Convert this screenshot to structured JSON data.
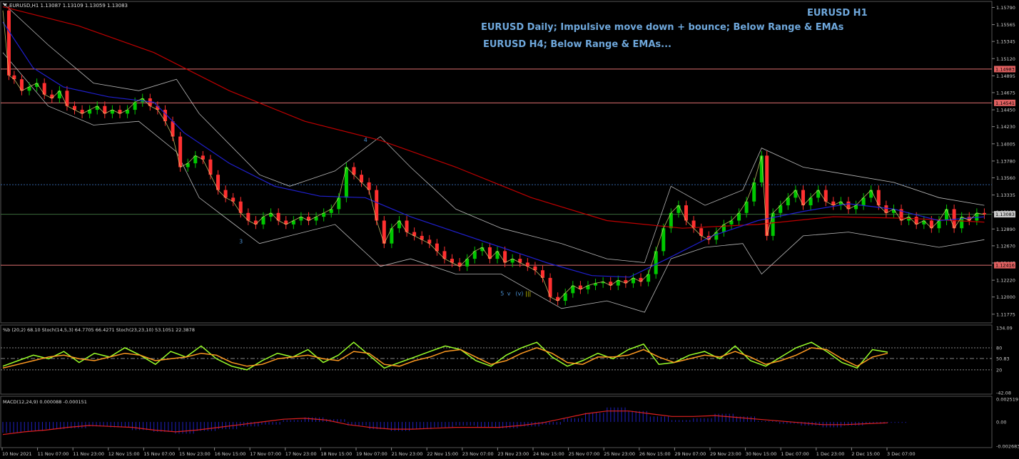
{
  "window": {
    "symbol_header": "EURUSD,H1  1.13087 1.13109 1.13059 1.13083",
    "corner_icon": "triangle-down-icon"
  },
  "annotations": {
    "title_h1": "EURUSD H1",
    "daily_note": "EURUSD Daily; Impulsive move down + bounce; Below Range & EMAs",
    "h4_note": "EURUSD H4; Below Range & EMAs..."
  },
  "wave_labels": [
    "3",
    "4",
    "5",
    "v",
    "(v)",
    "|||"
  ],
  "colors": {
    "background": "#000000",
    "bull_candle": "#00c800",
    "bear_candle": "#ff3030",
    "ema_fast": "#e8e07a",
    "ema_slow": "#2020d0",
    "ema_long": "#c00000",
    "bands": "#b8b8b8",
    "annotation": "#6fa8dc",
    "level_line": "#e07070",
    "stoch_main": "#9aff2a",
    "stoch_slow": "#ff9a20",
    "macd_hist": "#2020c0",
    "macd_signal": "#e02020"
  },
  "chart_data": [
    {
      "type": "candlestick",
      "pane": "price",
      "title": "EURUSD,H1",
      "ylim": [
        1.1168,
        1.1585
      ],
      "y_ticks": [
        "1.15790",
        "1.15565",
        "1.15345",
        "1.15120",
        "1.14895",
        "1.14675",
        "1.14450",
        "1.14230",
        "1.14005",
        "1.13780",
        "1.13560",
        "1.13335",
        "1.13110",
        "1.12890",
        "1.12670",
        "1.12445",
        "1.12220",
        "1.12000",
        "1.11775"
      ],
      "price_labels": [
        {
          "value": 1.14983,
          "text": "1.14983"
        },
        {
          "value": 1.14541,
          "text": "1.14541"
        },
        {
          "value": 1.13083,
          "text": "1.13083"
        },
        {
          "value": 1.12416,
          "text": "1.12416"
        }
      ],
      "horizontal_levels": [
        1.14983,
        1.14541,
        1.12416
      ],
      "current_price_line": 1.13083,
      "dotted_level": 1.1347,
      "x_labels": [
        "10 Nov 2021",
        "11 Nov 07:00",
        "11 Nov 23:00",
        "12 Nov 15:00",
        "15 Nov 07:00",
        "15 Nov 23:00",
        "16 Nov 15:00",
        "17 Nov 07:00",
        "17 Nov 23:00",
        "18 Nov 15:00",
        "19 Nov 07:00",
        "21 Nov 23:00",
        "22 Nov 15:00",
        "23 Nov 07:00",
        "23 Nov 23:00",
        "24 Nov 15:00",
        "25 Nov 07:00",
        "25 Nov 23:00",
        "26 Nov 15:00",
        "29 Nov 07:00",
        "29 Nov 23:00",
        "30 Nov 15:00",
        "1 Dec 07:00",
        "1 Dec 23:00",
        "2 Dec 15:00",
        "3 Dec 07:00"
      ],
      "close_path": [
        [
          0,
          1.1575
        ],
        [
          8,
          1.149
        ],
        [
          15,
          1.1485
        ],
        [
          25,
          1.147
        ],
        [
          35,
          1.1475
        ],
        [
          45,
          1.148
        ],
        [
          55,
          1.1465
        ],
        [
          65,
          1.146
        ],
        [
          75,
          1.147
        ],
        [
          85,
          1.145
        ],
        [
          95,
          1.1445
        ],
        [
          105,
          1.144
        ],
        [
          115,
          1.1445
        ],
        [
          125,
          1.145
        ],
        [
          135,
          1.144
        ],
        [
          145,
          1.1445
        ],
        [
          155,
          1.144
        ],
        [
          165,
          1.1445
        ],
        [
          175,
          1.1455
        ],
        [
          185,
          1.146
        ],
        [
          195,
          1.145
        ],
        [
          205,
          1.1445
        ],
        [
          215,
          1.143
        ],
        [
          225,
          1.141
        ],
        [
          235,
          1.137
        ],
        [
          245,
          1.1375
        ],
        [
          255,
          1.1385
        ],
        [
          265,
          1.138
        ],
        [
          275,
          1.136
        ],
        [
          285,
          1.134
        ],
        [
          295,
          1.133
        ],
        [
          305,
          1.1325
        ],
        [
          315,
          1.131
        ],
        [
          325,
          1.13
        ],
        [
          335,
          1.1295
        ],
        [
          345,
          1.1305
        ],
        [
          355,
          1.131
        ],
        [
          365,
          1.13
        ],
        [
          375,
          1.1295
        ],
        [
          385,
          1.13
        ],
        [
          395,
          1.1305
        ],
        [
          405,
          1.13
        ],
        [
          415,
          1.1305
        ],
        [
          425,
          1.131
        ],
        [
          435,
          1.1315
        ],
        [
          445,
          1.133
        ],
        [
          455,
          1.137
        ],
        [
          465,
          1.136
        ],
        [
          475,
          1.135
        ],
        [
          485,
          1.134
        ],
        [
          495,
          1.13
        ],
        [
          505,
          1.127
        ],
        [
          515,
          1.129
        ],
        [
          525,
          1.13
        ],
        [
          535,
          1.1285
        ],
        [
          545,
          1.128
        ],
        [
          555,
          1.1275
        ],
        [
          565,
          1.127
        ],
        [
          575,
          1.126
        ],
        [
          585,
          1.125
        ],
        [
          595,
          1.1245
        ],
        [
          605,
          1.124
        ],
        [
          615,
          1.125
        ],
        [
          625,
          1.126
        ],
        [
          635,
          1.1265
        ],
        [
          645,
          1.125
        ],
        [
          655,
          1.126
        ],
        [
          665,
          1.1245
        ],
        [
          675,
          1.125
        ],
        [
          685,
          1.1245
        ],
        [
          695,
          1.124
        ],
        [
          705,
          1.1235
        ],
        [
          715,
          1.1225
        ],
        [
          725,
          1.12
        ],
        [
          735,
          1.1195
        ],
        [
          745,
          1.1205
        ],
        [
          755,
          1.1215
        ],
        [
          765,
          1.121
        ],
        [
          775,
          1.1215
        ],
        [
          785,
          1.1218
        ],
        [
          795,
          1.122
        ],
        [
          805,
          1.1215
        ],
        [
          815,
          1.1222
        ],
        [
          825,
          1.1218
        ],
        [
          835,
          1.1225
        ],
        [
          845,
          1.122
        ],
        [
          855,
          1.123
        ],
        [
          865,
          1.126
        ],
        [
          875,
          1.129
        ],
        [
          885,
          1.131
        ],
        [
          895,
          1.132
        ],
        [
          905,
          1.13
        ],
        [
          915,
          1.129
        ],
        [
          925,
          1.128
        ],
        [
          935,
          1.1275
        ],
        [
          945,
          1.1285
        ],
        [
          955,
          1.1295
        ],
        [
          965,
          1.13
        ],
        [
          975,
          1.131
        ],
        [
          985,
          1.1325
        ],
        [
          995,
          1.135
        ],
        [
          1005,
          1.1385
        ],
        [
          1012,
          1.128
        ],
        [
          1020,
          1.131
        ],
        [
          1030,
          1.132
        ],
        [
          1040,
          1.133
        ],
        [
          1050,
          1.134
        ],
        [
          1060,
          1.132
        ],
        [
          1070,
          1.133
        ],
        [
          1080,
          1.134
        ],
        [
          1090,
          1.1325
        ],
        [
          1100,
          1.132
        ],
        [
          1110,
          1.1325
        ],
        [
          1120,
          1.1315
        ],
        [
          1130,
          1.132
        ],
        [
          1140,
          1.133
        ],
        [
          1150,
          1.134
        ],
        [
          1160,
          1.132
        ],
        [
          1170,
          1.131
        ],
        [
          1180,
          1.1315
        ],
        [
          1190,
          1.13
        ],
        [
          1200,
          1.1305
        ],
        [
          1210,
          1.1295
        ],
        [
          1220,
          1.13
        ],
        [
          1230,
          1.129
        ],
        [
          1240,
          1.13
        ],
        [
          1250,
          1.1315
        ],
        [
          1260,
          1.129
        ],
        [
          1270,
          1.1305
        ],
        [
          1280,
          1.13
        ],
        [
          1290,
          1.131
        ],
        [
          1300,
          1.1308
        ]
      ],
      "ema_slow_path": [
        [
          0,
          1.156
        ],
        [
          40,
          1.15
        ],
        [
          80,
          1.1475
        ],
        [
          140,
          1.1462
        ],
        [
          200,
          1.1455
        ],
        [
          240,
          1.1415
        ],
        [
          300,
          1.1375
        ],
        [
          360,
          1.1345
        ],
        [
          420,
          1.1332
        ],
        [
          480,
          1.133
        ],
        [
          540,
          1.1305
        ],
        [
          600,
          1.1285
        ],
        [
          660,
          1.1265
        ],
        [
          720,
          1.1245
        ],
        [
          780,
          1.1228
        ],
        [
          830,
          1.1226
        ],
        [
          880,
          1.125
        ],
        [
          940,
          1.128
        ],
        [
          1000,
          1.13
        ],
        [
          1060,
          1.1312
        ],
        [
          1120,
          1.1322
        ],
        [
          1180,
          1.1315
        ],
        [
          1240,
          1.13
        ],
        [
          1300,
          1.1305
        ]
      ],
      "ema_long_path": [
        [
          0,
          1.158
        ],
        [
          100,
          1.1555
        ],
        [
          200,
          1.152
        ],
        [
          300,
          1.147
        ],
        [
          400,
          1.143
        ],
        [
          500,
          1.1405
        ],
        [
          600,
          1.137
        ],
        [
          700,
          1.133
        ],
        [
          800,
          1.13
        ],
        [
          900,
          1.129
        ],
        [
          1000,
          1.1295
        ],
        [
          1100,
          1.1305
        ],
        [
          1200,
          1.1303
        ],
        [
          1300,
          1.1298
        ]
      ],
      "upper_band_path": [
        [
          0,
          1.1585
        ],
        [
          60,
          1.153
        ],
        [
          120,
          1.148
        ],
        [
          180,
          1.147
        ],
        [
          230,
          1.1485
        ],
        [
          260,
          1.144
        ],
        [
          300,
          1.14
        ],
        [
          340,
          1.136
        ],
        [
          380,
          1.1345
        ],
        [
          440,
          1.1365
        ],
        [
          500,
          1.141
        ],
        [
          540,
          1.137
        ],
        [
          600,
          1.1315
        ],
        [
          660,
          1.129
        ],
        [
          740,
          1.127
        ],
        [
          800,
          1.125
        ],
        [
          850,
          1.1245
        ],
        [
          885,
          1.1345
        ],
        [
          930,
          1.132
        ],
        [
          980,
          1.134
        ],
        [
          1005,
          1.1395
        ],
        [
          1060,
          1.137
        ],
        [
          1120,
          1.136
        ],
        [
          1180,
          1.135
        ],
        [
          1240,
          1.133
        ],
        [
          1300,
          1.132
        ]
      ],
      "lower_band_path": [
        [
          0,
          1.152
        ],
        [
          60,
          1.145
        ],
        [
          120,
          1.1425
        ],
        [
          180,
          1.143
        ],
        [
          230,
          1.139
        ],
        [
          260,
          1.133
        ],
        [
          300,
          1.13
        ],
        [
          340,
          1.127
        ],
        [
          380,
          1.128
        ],
        [
          440,
          1.1295
        ],
        [
          500,
          1.124
        ],
        [
          540,
          1.125
        ],
        [
          600,
          1.123
        ],
        [
          660,
          1.123
        ],
        [
          740,
          1.1185
        ],
        [
          800,
          1.1195
        ],
        [
          850,
          1.118
        ],
        [
          885,
          1.125
        ],
        [
          930,
          1.1265
        ],
        [
          980,
          1.127
        ],
        [
          1005,
          1.123
        ],
        [
          1060,
          1.128
        ],
        [
          1120,
          1.1285
        ],
        [
          1180,
          1.1275
        ],
        [
          1240,
          1.1265
        ],
        [
          1300,
          1.1275
        ]
      ],
      "wave_markers": [
        {
          "label_index": 0,
          "x": 313,
          "value": 1.127
        },
        {
          "label_index": 1,
          "x": 478,
          "value": 1.1403
        },
        {
          "label_index": 2,
          "x": 659,
          "value": 1.1202
        },
        {
          "label_index": 3,
          "x": 668,
          "value": 1.1202
        },
        {
          "label_index": 4,
          "x": 679,
          "value": 1.1202
        },
        {
          "label_index": 5,
          "x": 692,
          "value": 1.1202
        }
      ]
    },
    {
      "type": "line",
      "pane": "oscillator",
      "title": "%b (20,2) 68.10  Stoch(14,5,3) 64.7705 66.4271  Stoch(23,23,10) 53.1051 22.3878",
      "ylim": [
        -42.08,
        134.09
      ],
      "y_ticks": [
        "134.09",
        "80",
        "50.83",
        "20",
        "-42.08"
      ],
      "levels": [
        80,
        50.83,
        20
      ],
      "series": [
        {
          "name": "%b (20,2)",
          "values": [
            30,
            45,
            60,
            50,
            70,
            40,
            65,
            55,
            80,
            60,
            35,
            70,
            55,
            85,
            50,
            30,
            20,
            45,
            65,
            55,
            75,
            40,
            60,
            95,
            60,
            25,
            40,
            55,
            70,
            85,
            75,
            45,
            30,
            60,
            80,
            95,
            55,
            30,
            45,
            65,
            50,
            75,
            90,
            35,
            40,
            60,
            70,
            50,
            85,
            45,
            30,
            55,
            80,
            95,
            70,
            40,
            25,
            75,
            68
          ]
        },
        {
          "name": "Stoch(14,5,3)",
          "values": [
            25,
            35,
            45,
            55,
            60,
            50,
            45,
            55,
            65,
            60,
            45,
            50,
            55,
            65,
            60,
            40,
            30,
            35,
            50,
            55,
            60,
            50,
            45,
            70,
            65,
            35,
            30,
            45,
            55,
            70,
            75,
            55,
            35,
            45,
            65,
            80,
            65,
            40,
            35,
            55,
            55,
            60,
            75,
            55,
            40,
            50,
            60,
            55,
            70,
            55,
            35,
            45,
            60,
            80,
            75,
            50,
            30,
            55,
            65
          ]
        }
      ]
    },
    {
      "type": "bar",
      "pane": "macd",
      "title": "MACD(12,24,9) 0.000088 -0.000151",
      "ylim": [
        -0.002683,
        0.002519
      ],
      "y_ticks": [
        "0.002519",
        "0.00",
        "-0.002683"
      ],
      "histogram": [
        -0.0012,
        -0.001,
        -0.0008,
        -0.0007,
        -0.0005,
        -0.0006,
        -0.0009,
        -0.0011,
        -0.0013,
        -0.001,
        -0.0008,
        -0.0005,
        -0.0003,
        0.0002,
        0.0005,
        0.0003,
        -0.0004,
        -0.0008,
        -0.001,
        -0.0008,
        -0.0006,
        -0.0004,
        -0.0006,
        -0.0007,
        -0.0005,
        -0.0003,
        0.0004,
        0.001,
        0.0016,
        0.0012,
        0.0006,
        0.0002,
        0.0004,
        0.0009,
        0.0006,
        0.0001,
        -0.0002,
        -0.0004,
        -0.0006,
        -0.0004,
        -0.0002,
        -0.0001
      ],
      "signal": [
        -0.0014,
        -0.0011,
        -0.0009,
        -0.0006,
        -0.0004,
        -0.0005,
        -0.0006,
        -0.0009,
        -0.0011,
        -0.0009,
        -0.0006,
        -0.0003,
        0.0,
        0.0003,
        0.0004,
        0.0002,
        -0.0003,
        -0.0006,
        -0.0008,
        -0.0008,
        -0.0007,
        -0.0006,
        -0.0006,
        -0.0006,
        -0.0004,
        -0.0001,
        0.0004,
        0.0009,
        0.0012,
        0.0012,
        0.0009,
        0.0006,
        0.0006,
        0.0007,
        0.0005,
        0.0003,
        0.0001,
        -0.0001,
        -0.0003,
        -0.0003,
        -0.0002,
        -0.0001
      ]
    }
  ]
}
